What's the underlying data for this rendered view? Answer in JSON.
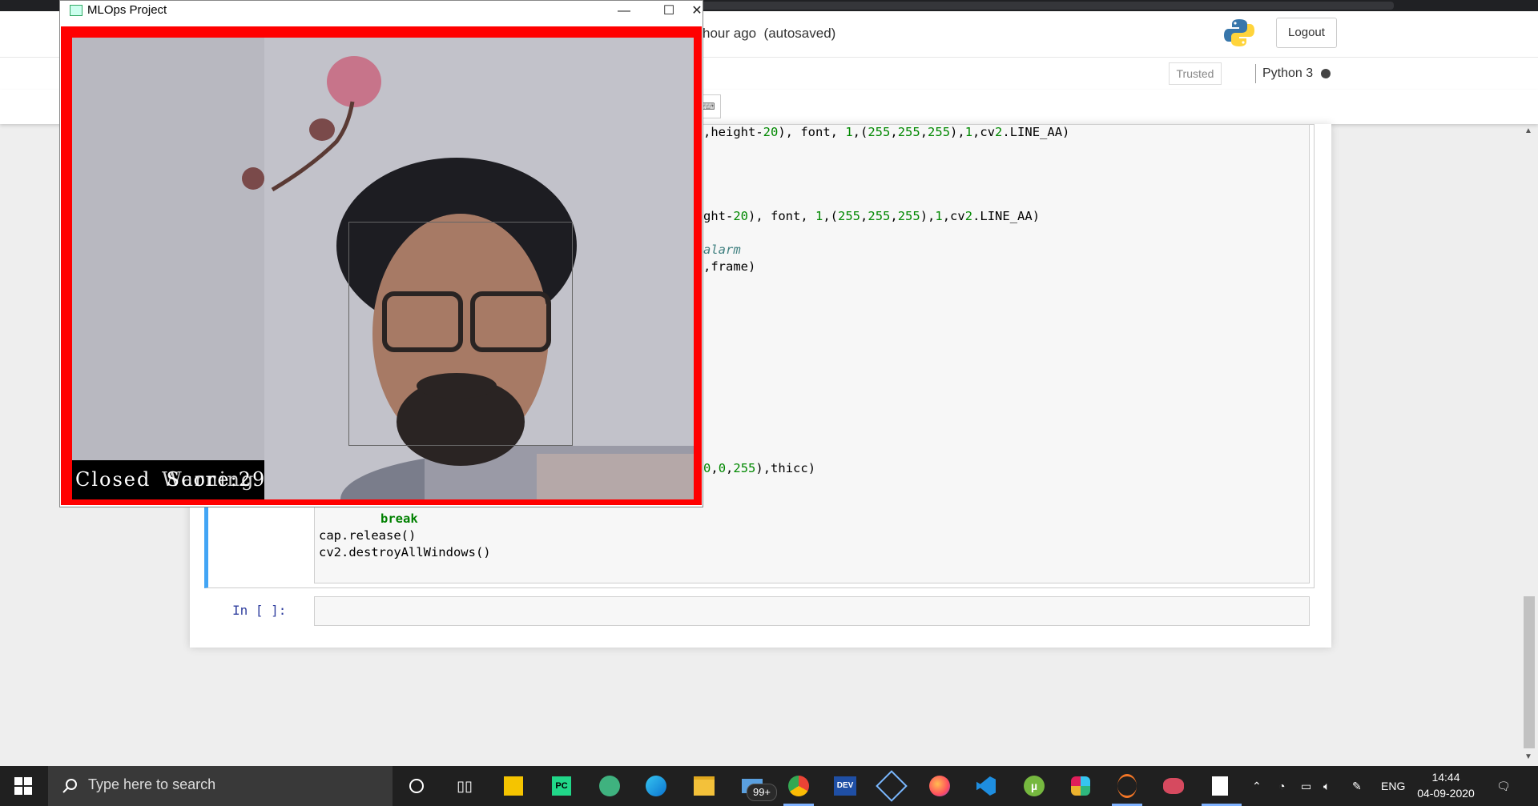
{
  "notebook": {
    "save_status": "hour ago  (autosaved)",
    "logout_label": "Logout",
    "trusted_label": "Trusted",
    "kernel_name": "Python 3",
    "empty_prompt": "In [ ]:",
    "code_lines": {
      "l1": ",height-20), font, 1,(255,255,255),1,cv2.LINE_AA)",
      "l2": "ght-20), font, 1,(255,255,255),1,cv2.LINE_AA)",
      "l3": "alarm",
      "l4": ",frame)",
      "l5": "0,0,255),thicc)",
      "l6": "break",
      "l7": "cap.release()",
      "l8": "cv2.destroyAllWindows()"
    }
  },
  "cv_window": {
    "title": "MLOps Project",
    "overlay_text": "Closed  Score:29",
    "overlay_text_ghost": "Warning",
    "icons": {
      "minimize": "minimize-icon",
      "maximize": "maximize-icon",
      "close": "close-icon"
    }
  },
  "taskbar": {
    "search_placeholder": "Type here to search",
    "badge_count": "99+",
    "language": "ENG",
    "time": "14:44",
    "date": "04-09-2020"
  },
  "colors": {
    "frame_red": "#ff0000",
    "cell_accent": "#42a5f5",
    "taskbar_bg": "#202020"
  }
}
